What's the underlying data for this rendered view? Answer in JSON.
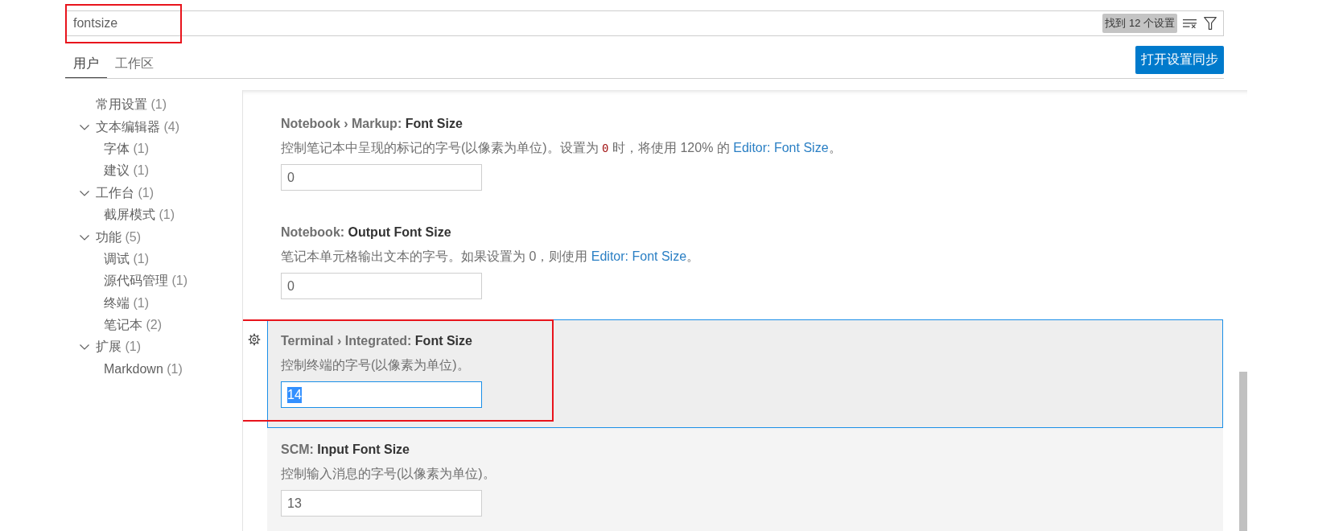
{
  "search": {
    "value": "fontsize",
    "result_badge": "找到 12 个设置",
    "annotated": true
  },
  "tabs": [
    {
      "label": "用户",
      "selected": true
    },
    {
      "label": "工作区",
      "selected": false
    }
  ],
  "sync_button": {
    "label": "打开设置同步"
  },
  "toc": [
    {
      "label": "常用设置",
      "count": "(1)"
    },
    {
      "label": "文本编辑器",
      "count": "(4)",
      "expanded": true,
      "children": [
        {
          "label": "字体",
          "count": "(1)"
        },
        {
          "label": "建议",
          "count": "(1)"
        }
      ]
    },
    {
      "label": "工作台",
      "count": "(1)",
      "expanded": true,
      "children": [
        {
          "label": "截屏模式",
          "count": "(1)"
        }
      ]
    },
    {
      "label": "功能",
      "count": "(5)",
      "expanded": true,
      "children": [
        {
          "label": "调试",
          "count": "(1)"
        },
        {
          "label": "源代码管理",
          "count": "(1)"
        },
        {
          "label": "终端",
          "count": "(1)"
        },
        {
          "label": "笔记本",
          "count": "(2)"
        }
      ]
    },
    {
      "label": "扩展",
      "count": "(1)",
      "expanded": true,
      "children": [
        {
          "label": "Markdown",
          "count": "(1)"
        }
      ]
    }
  ],
  "settings": [
    {
      "category": "Notebook › Markup:",
      "name": "Font Size",
      "description": [
        {
          "kind": "text",
          "text": "控制笔记本中呈现的标记的字号(以像素为单位)。设置为 "
        },
        {
          "kind": "code",
          "text": "0"
        },
        {
          "kind": "text",
          "text": " 时，将使用 120% 的 "
        },
        {
          "kind": "link",
          "text": "Editor: Font Size"
        },
        {
          "kind": "text",
          "text": "。"
        }
      ],
      "value": "0",
      "focused": false
    },
    {
      "category": "Notebook:",
      "name": "Output Font Size",
      "description": [
        {
          "kind": "text",
          "text": "笔记本单元格输出文本的字号。如果设置为 0，则使用 "
        },
        {
          "kind": "link",
          "text": "Editor: Font Size"
        },
        {
          "kind": "text",
          "text": "。"
        }
      ],
      "value": "0",
      "focused": false
    },
    {
      "category": "Terminal › Integrated:",
      "name": "Font Size",
      "description": [
        {
          "kind": "text",
          "text": "控制终端的字号(以像素为单位)。"
        }
      ],
      "value": "14",
      "focused": true,
      "annotated": true
    },
    {
      "category": "SCM:",
      "name": "Input Font Size",
      "description": [
        {
          "kind": "text",
          "text": "控制输入消息的字号(以像素为单位)。"
        }
      ],
      "value": "13",
      "focused": false,
      "hovered": true
    }
  ]
}
